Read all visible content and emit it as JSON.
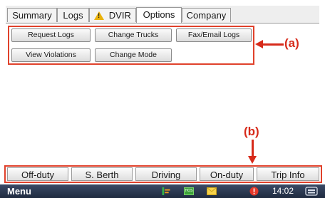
{
  "tabs": [
    {
      "label": "Summary"
    },
    {
      "label": "Logs"
    },
    {
      "label": "DVIR"
    },
    {
      "label": "Options"
    },
    {
      "label": "Company"
    }
  ],
  "buttons": {
    "request_logs": "Request Logs",
    "change_trucks": "Change Trucks",
    "fax_email_logs": "Fax/Email Logs",
    "view_violations": "View Violations",
    "change_mode": "Change Mode"
  },
  "callouts": {
    "a": "(a)",
    "b": "(b)"
  },
  "duty": [
    {
      "label": "Off-duty"
    },
    {
      "label": "S. Berth"
    },
    {
      "label": "Driving"
    },
    {
      "label": "On-duty"
    },
    {
      "label": "Trip Info"
    }
  ],
  "taskbar": {
    "menu": "Menu",
    "hos_icon_label": "HOS",
    "clock": "14:02"
  },
  "colors": {
    "annotation_red": "#d72a1a",
    "taskbar_bg": "#263450",
    "warning_yellow": "#e9b10a"
  },
  "icons": [
    "warning-icon",
    "bars-icon",
    "hos-icon",
    "mail-icon",
    "alert-icon",
    "tray-icon"
  ]
}
